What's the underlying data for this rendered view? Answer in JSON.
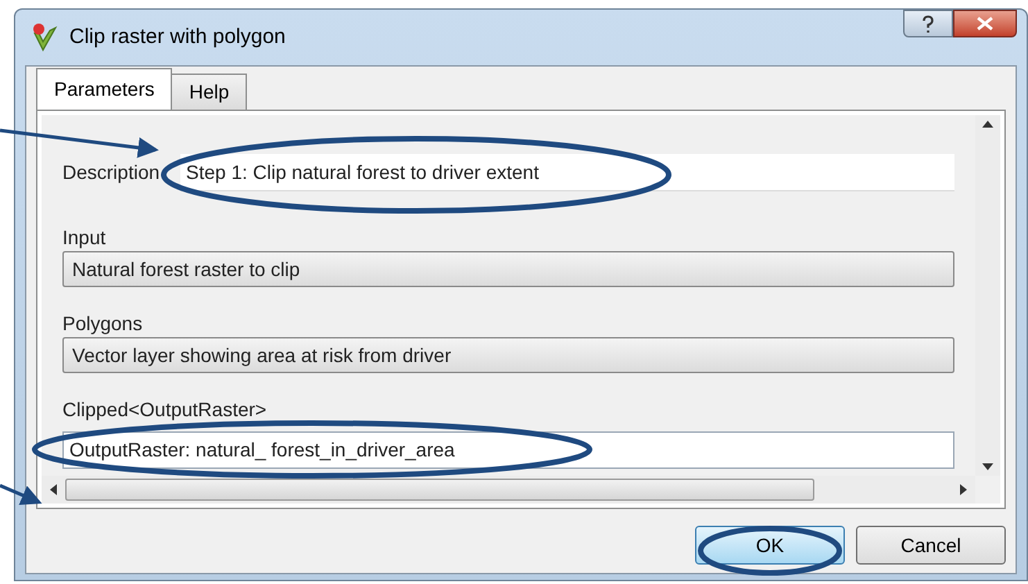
{
  "window": {
    "title": "Clip raster with polygon"
  },
  "tabs": [
    {
      "label": "Parameters",
      "selected": true
    },
    {
      "label": "Help",
      "selected": false
    }
  ],
  "description": {
    "label": "Description",
    "value": "Step 1: Clip natural forest to driver extent"
  },
  "parameters": [
    {
      "kind": "combo",
      "label": "Input",
      "value": "Natural forest raster to clip"
    },
    {
      "kind": "combo",
      "label": "Polygons",
      "value": "Vector layer showing area at risk from driver"
    },
    {
      "kind": "text",
      "label": "Clipped<OutputRaster>",
      "value": "OutputRaster: natural_ forest_in_driver_area"
    }
  ],
  "buttons": [
    {
      "label": "OK",
      "default": true
    },
    {
      "label": "Cancel",
      "default": false
    }
  ]
}
